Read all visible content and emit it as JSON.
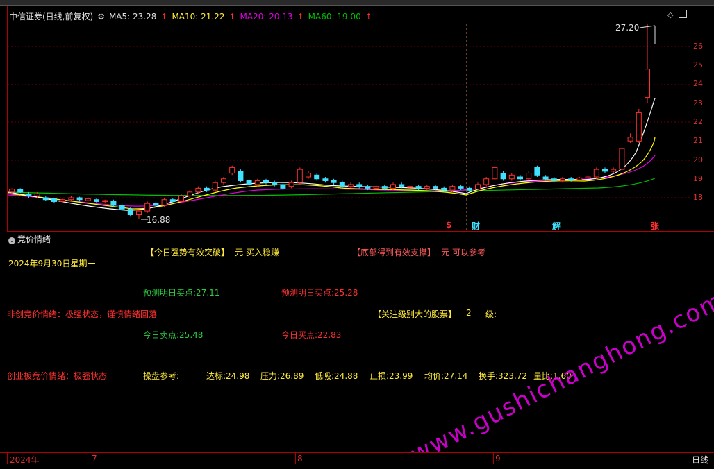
{
  "header": {
    "stock_name": "中信证券(日线,前复权)",
    "ma5": "MA5: 23.28",
    "ma10": "MA10: 21.22",
    "ma20": "MA20: 20.13",
    "ma60": "MA60: 19.00",
    "arrow": "↑"
  },
  "price_axis": [
    "26",
    "25",
    "24",
    "23",
    "22",
    "21",
    "20",
    "19",
    "18"
  ],
  "annotations": {
    "high": "27.20",
    "low": "16.88"
  },
  "events": [
    "$",
    "财",
    "解",
    "张"
  ],
  "indicator": {
    "title": "竞价情绪",
    "date": "2024年9月30日星期一",
    "breakout": "【今日强势有效突破】- 元 买入稳赚",
    "support": "【底部得到有效支撑】- 元 可以参考",
    "pred_sell": "预测明日卖点:27.11",
    "pred_buy": "预测明日买点:25.28",
    "mainboard": "非创竞价情绪：极强状态，谨慎情绪回落",
    "focus_label": "【关注级别大的股票】",
    "focus_level": "2",
    "focus_unit": "级:",
    "today_sell": "今日卖点:25.48",
    "today_buy": "今日买点:22.83",
    "chinext": "创业板竞价情绪：极强状态",
    "ref_label": "操盘参考:",
    "target": "达标:24.98",
    "pressure": "压力:26.89",
    "low_absorb": "低吸:24.88",
    "stop_loss": "止损:23.99",
    "avg_price": "均价:27.14",
    "turnover": "换手:323.72",
    "volume_ratio": "量比:1.60"
  },
  "date_axis": {
    "year": "2024年",
    "m7": "7",
    "m8": "8",
    "m9": "9",
    "right": "日线"
  },
  "watermark": "www.gushichanghong.com",
  "colors": {
    "up": "#ff3030",
    "down": "#40e0ff",
    "ma5": "#ffffff",
    "ma10": "#ffff00",
    "ma20": "#e000e0",
    "ma60": "#00c000"
  },
  "icons": {
    "settings": "gear-icon",
    "panel": "circle-chevron-icon",
    "diamond": "diamond-icon",
    "square": "square-icon"
  }
}
